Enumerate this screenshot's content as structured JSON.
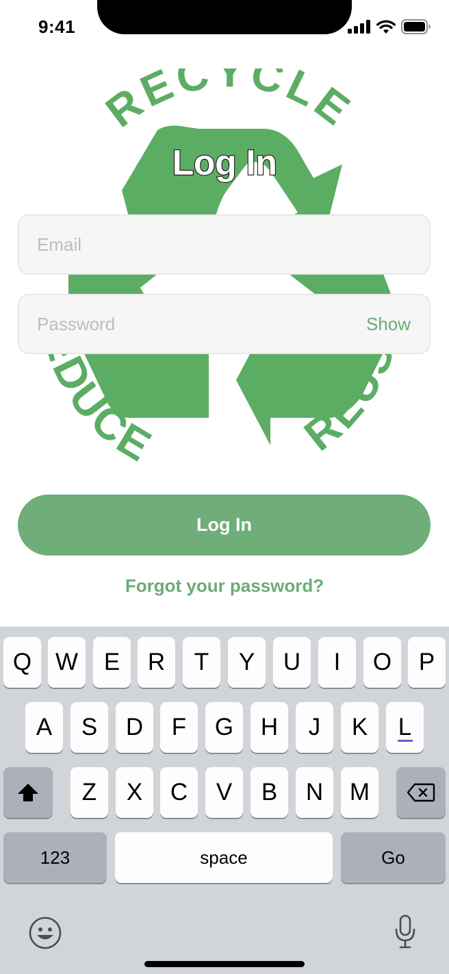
{
  "status_bar": {
    "time": "9:41"
  },
  "logo": {
    "top_word": "RECYCLE",
    "left_word": "REDUCE",
    "right_word": "REUSE",
    "color": "#5cad64"
  },
  "title": "Log In",
  "email": {
    "placeholder": "Email",
    "value": ""
  },
  "password": {
    "placeholder": "Password",
    "value": "",
    "toggle_label": "Show"
  },
  "login_button": {
    "label": "Log In",
    "color": "#6fae79"
  },
  "forgot_link": "Forgot your password?",
  "accent_color": "#6aac74",
  "keyboard": {
    "row1": [
      "Q",
      "W",
      "E",
      "R",
      "T",
      "Y",
      "U",
      "I",
      "O",
      "P"
    ],
    "row2": [
      "A",
      "S",
      "D",
      "F",
      "G",
      "H",
      "J",
      "K",
      "L"
    ],
    "row3": [
      "Z",
      "X",
      "C",
      "V",
      "B",
      "N",
      "M"
    ],
    "numbers_key": "123",
    "space_key": "space",
    "go_key": "Go",
    "icons": [
      "shift-icon",
      "delete-icon",
      "emoji-icon",
      "microphone-icon"
    ]
  }
}
